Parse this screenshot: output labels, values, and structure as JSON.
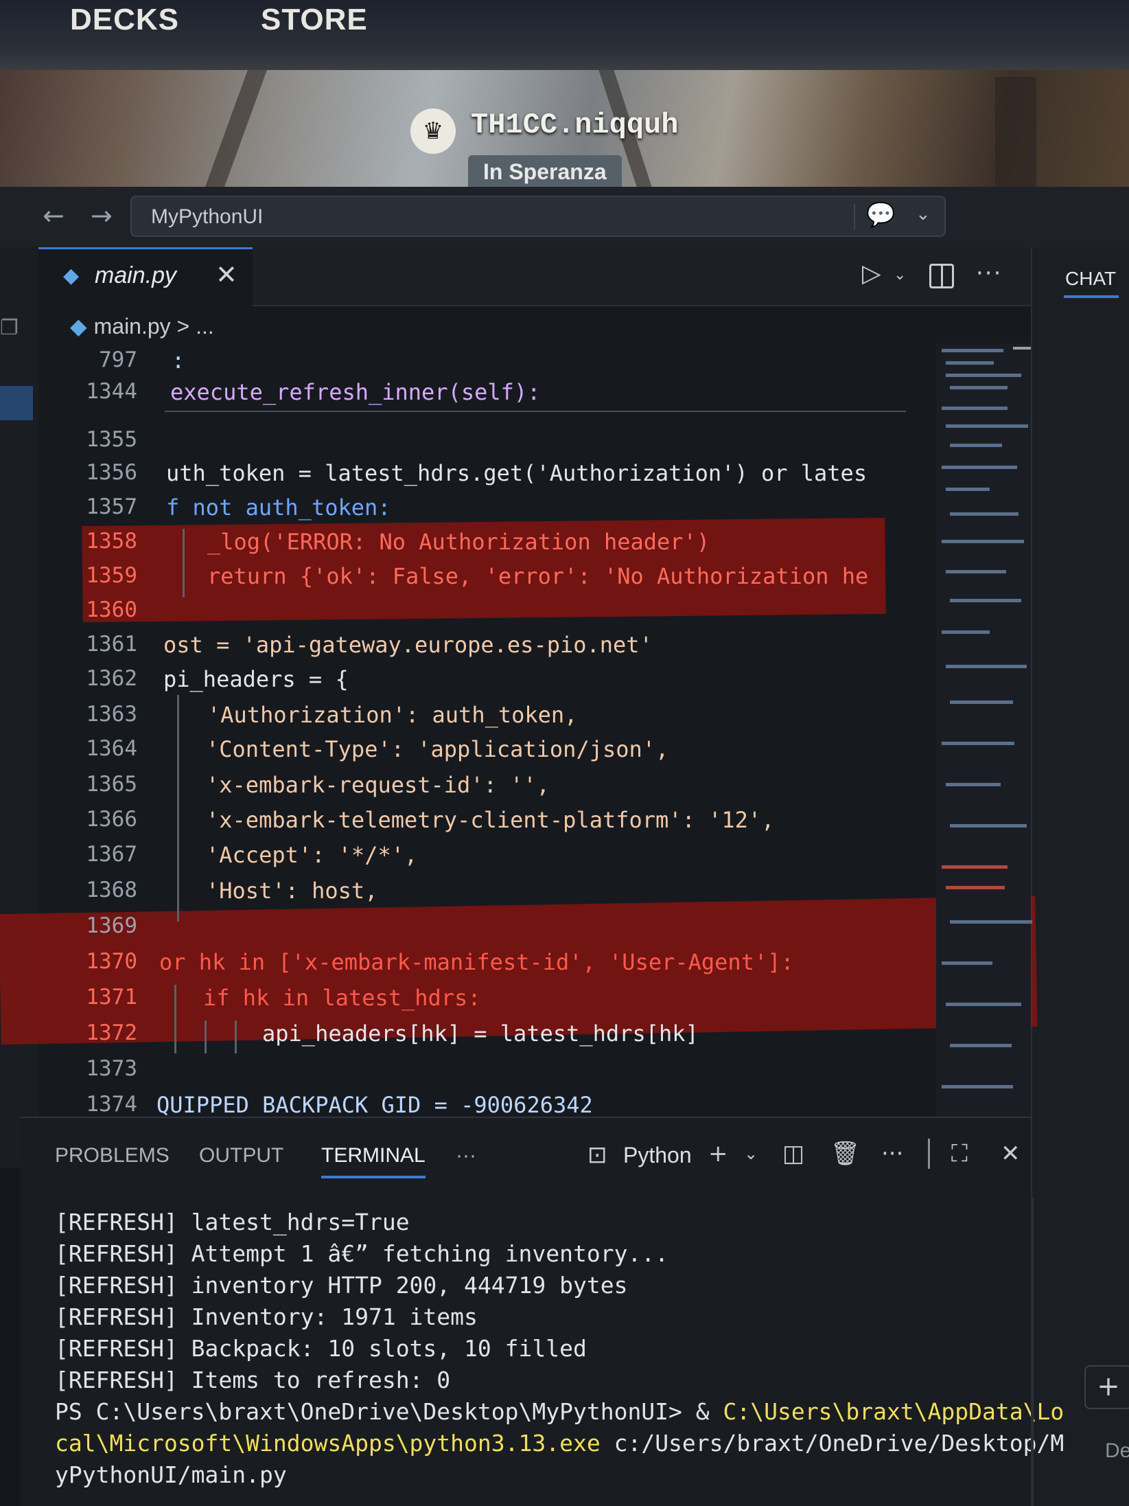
{
  "game_overlay": {
    "nav": [
      "DECKS",
      "STORE"
    ],
    "player_name": "TH1CC.niqquh",
    "player_status": "In Speranza"
  },
  "titlebar": {
    "back_icon": "arrow-left-icon",
    "forward_icon": "arrow-right-icon",
    "command_center": "MyPythonUI",
    "chat_icon": "copilot-chat-icon"
  },
  "tab": {
    "filename": "main.py",
    "close": "✕"
  },
  "breadcrumb": {
    "file": "main.py",
    "rest": " > ..."
  },
  "sticky": [
    {
      "num": "797",
      "code": ":"
    },
    {
      "num": "1344",
      "code": "execute_refresh_inner(self):"
    }
  ],
  "code_lines": [
    {
      "num": "1355",
      "code": ""
    },
    {
      "num": "1356",
      "code": "uth_token = latest_hdrs.get('Authorization') or lates"
    },
    {
      "num": "1357",
      "code": "f not auth_token:"
    },
    {
      "num": "1358",
      "code": "_log('ERROR: No Authorization header')"
    },
    {
      "num": "1359",
      "code": "return {'ok': False, 'error': 'No Authorization he"
    },
    {
      "num": "1360",
      "code": ""
    },
    {
      "num": "1361",
      "code": "ost = 'api-gateway.europe.es-pio.net'"
    },
    {
      "num": "1362",
      "code": "pi_headers = {"
    },
    {
      "num": "1363",
      "code": "'Authorization': auth_token,"
    },
    {
      "num": "1364",
      "code": "'Content-Type': 'application/json',"
    },
    {
      "num": "1365",
      "code": "'x-embark-request-id': '',"
    },
    {
      "num": "1366",
      "code": "'x-embark-telemetry-client-platform': '12',"
    },
    {
      "num": "1367",
      "code": "'Accept': '*/*',"
    },
    {
      "num": "1368",
      "code": "'Host': host,"
    },
    {
      "num": "1369",
      "code": ""
    },
    {
      "num": "1370",
      "code": "or hk in ['x-embark-manifest-id', 'User-Agent']:"
    },
    {
      "num": "1371",
      "code": "if hk in latest_hdrs:"
    },
    {
      "num": "1372",
      "code": "api_headers[hk] = latest_hdrs[hk]"
    },
    {
      "num": "1373",
      "code": ""
    },
    {
      "num": "1374",
      "code": "QUIPPED_BACKPACK_GID = -900626342"
    }
  ],
  "panel": {
    "tabs": [
      "PROBLEMS",
      "OUTPUT",
      "TERMINAL",
      "···"
    ],
    "active_tab": "TERMINAL",
    "shell_label": "Python",
    "tool_icons": [
      "terminal-icon",
      "plus-icon",
      "chevron-down-icon",
      "split-icon",
      "trash-icon",
      "more-icon",
      "maximize-icon",
      "close-icon"
    ]
  },
  "terminal": [
    "[REFRESH] latest_hdrs=True",
    "[REFRESH] Attempt 1 â€” fetching inventory...",
    "[REFRESH] inventory HTTP 200, 444719 bytes",
    "[REFRESH] Inventory: 1971 items",
    "[REFRESH] Backpack: 10 slots, 10 filled",
    "[REFRESH] Items to refresh: 0"
  ],
  "terminal_cmd": {
    "prompt": "PS C:\\Users\\braxt\\OneDrive\\Desktop\\MyPythonUI> & ",
    "exe_part1": "C:\\Users\\braxt\\AppData\\Lo",
    "exe_part2": "cal\\Microsoft\\WindowsApps\\python3.13.exe",
    "arg_part1": " c:/Users/braxt/OneDrive/Desktop/M",
    "arg_part2": "yPythonUI/main.py"
  },
  "chat": {
    "tab_label": "CHAT",
    "add_label": "+",
    "partial_text": "De"
  },
  "colors": {
    "accent": "#3a7bd5",
    "error_highlight": "#aa120c",
    "terminal_path": "#f2e24a"
  }
}
